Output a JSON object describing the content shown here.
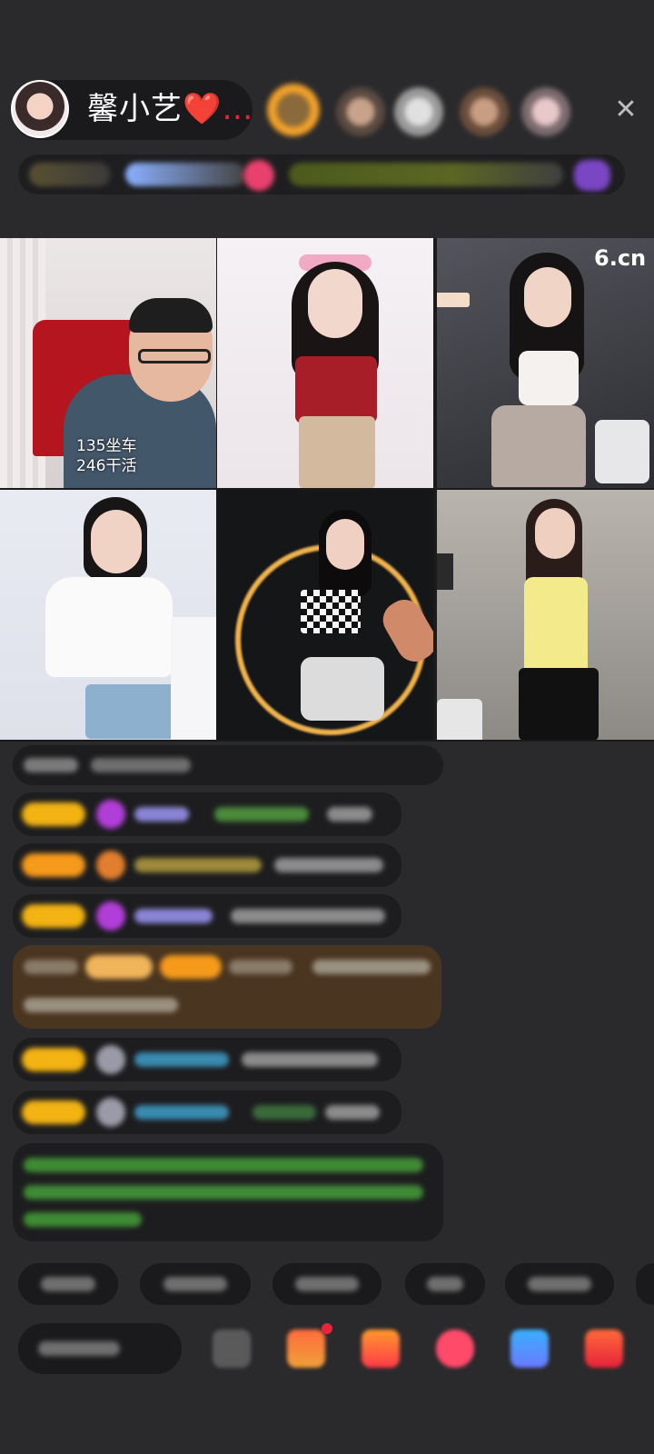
{
  "header": {
    "host_name": "馨小艺",
    "host_name_suffix": "❤️…",
    "viewers": [
      "viewer-1",
      "viewer-2",
      "viewer-3",
      "viewer-4",
      "viewer-5"
    ]
  },
  "grid": {
    "tile1_label_line1": "135坐车",
    "tile1_label_line2": "246干活",
    "watermark": "6.cn"
  },
  "colors": {
    "background": "#2a2a2c",
    "badge_gold": "#f2b313",
    "badge_orange": "#f59a1b",
    "highlight_message": "#4a3520",
    "green_text": "#59c53a"
  },
  "icons": [
    "close-icon",
    "gift-icon",
    "box-icon",
    "chat-icon",
    "share-icon"
  ]
}
